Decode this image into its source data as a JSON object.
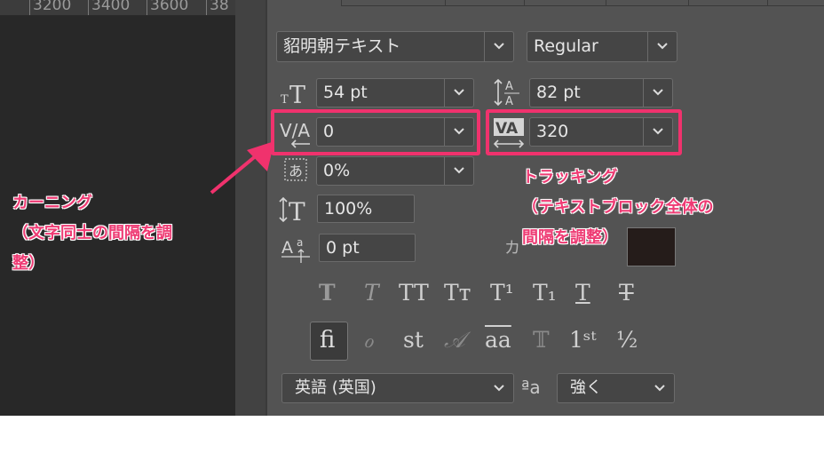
{
  "ruler": {
    "ticks": [
      "3200",
      "3400",
      "3600",
      "38"
    ]
  },
  "font": {
    "family": "貂明朝テキスト",
    "style": "Regular"
  },
  "char": {
    "size": "54 pt",
    "leading": "82 pt",
    "kerning": "0",
    "tracking": "320",
    "tsume": "0%",
    "vscale": "100%",
    "baseline": "0 pt",
    "color_label": "カ"
  },
  "styles": {
    "bold": "T",
    "italic": "T",
    "allcaps": "TT",
    "smallcaps": "Tᴛ",
    "superscript": "T¹",
    "subscript": "T₁",
    "underline": "T",
    "strike": "T"
  },
  "opentype": {
    "ligature": "ﬁ",
    "discretionary": "ℴ",
    "st": "st",
    "swash": "𝒜",
    "titling": "aa",
    "ornament": "𝕋",
    "ordinal": "1ˢᵗ",
    "fraction": "½"
  },
  "language": {
    "label": "英語 (英国)",
    "aa": "ªa",
    "aa_label": "強く"
  },
  "annotations": {
    "kerning": [
      "カーニング",
      "（文字同士の間隔を調",
      "整）"
    ],
    "tracking": [
      "トラッキング",
      "（テキストブロック全体の",
      "間隔を調整）"
    ]
  },
  "colors": {
    "highlight": "#f0326d",
    "annotation_text": "#ee3a73",
    "panel": "#535353",
    "canvas": "#282828",
    "text_color_swatch": "#251c1a"
  }
}
